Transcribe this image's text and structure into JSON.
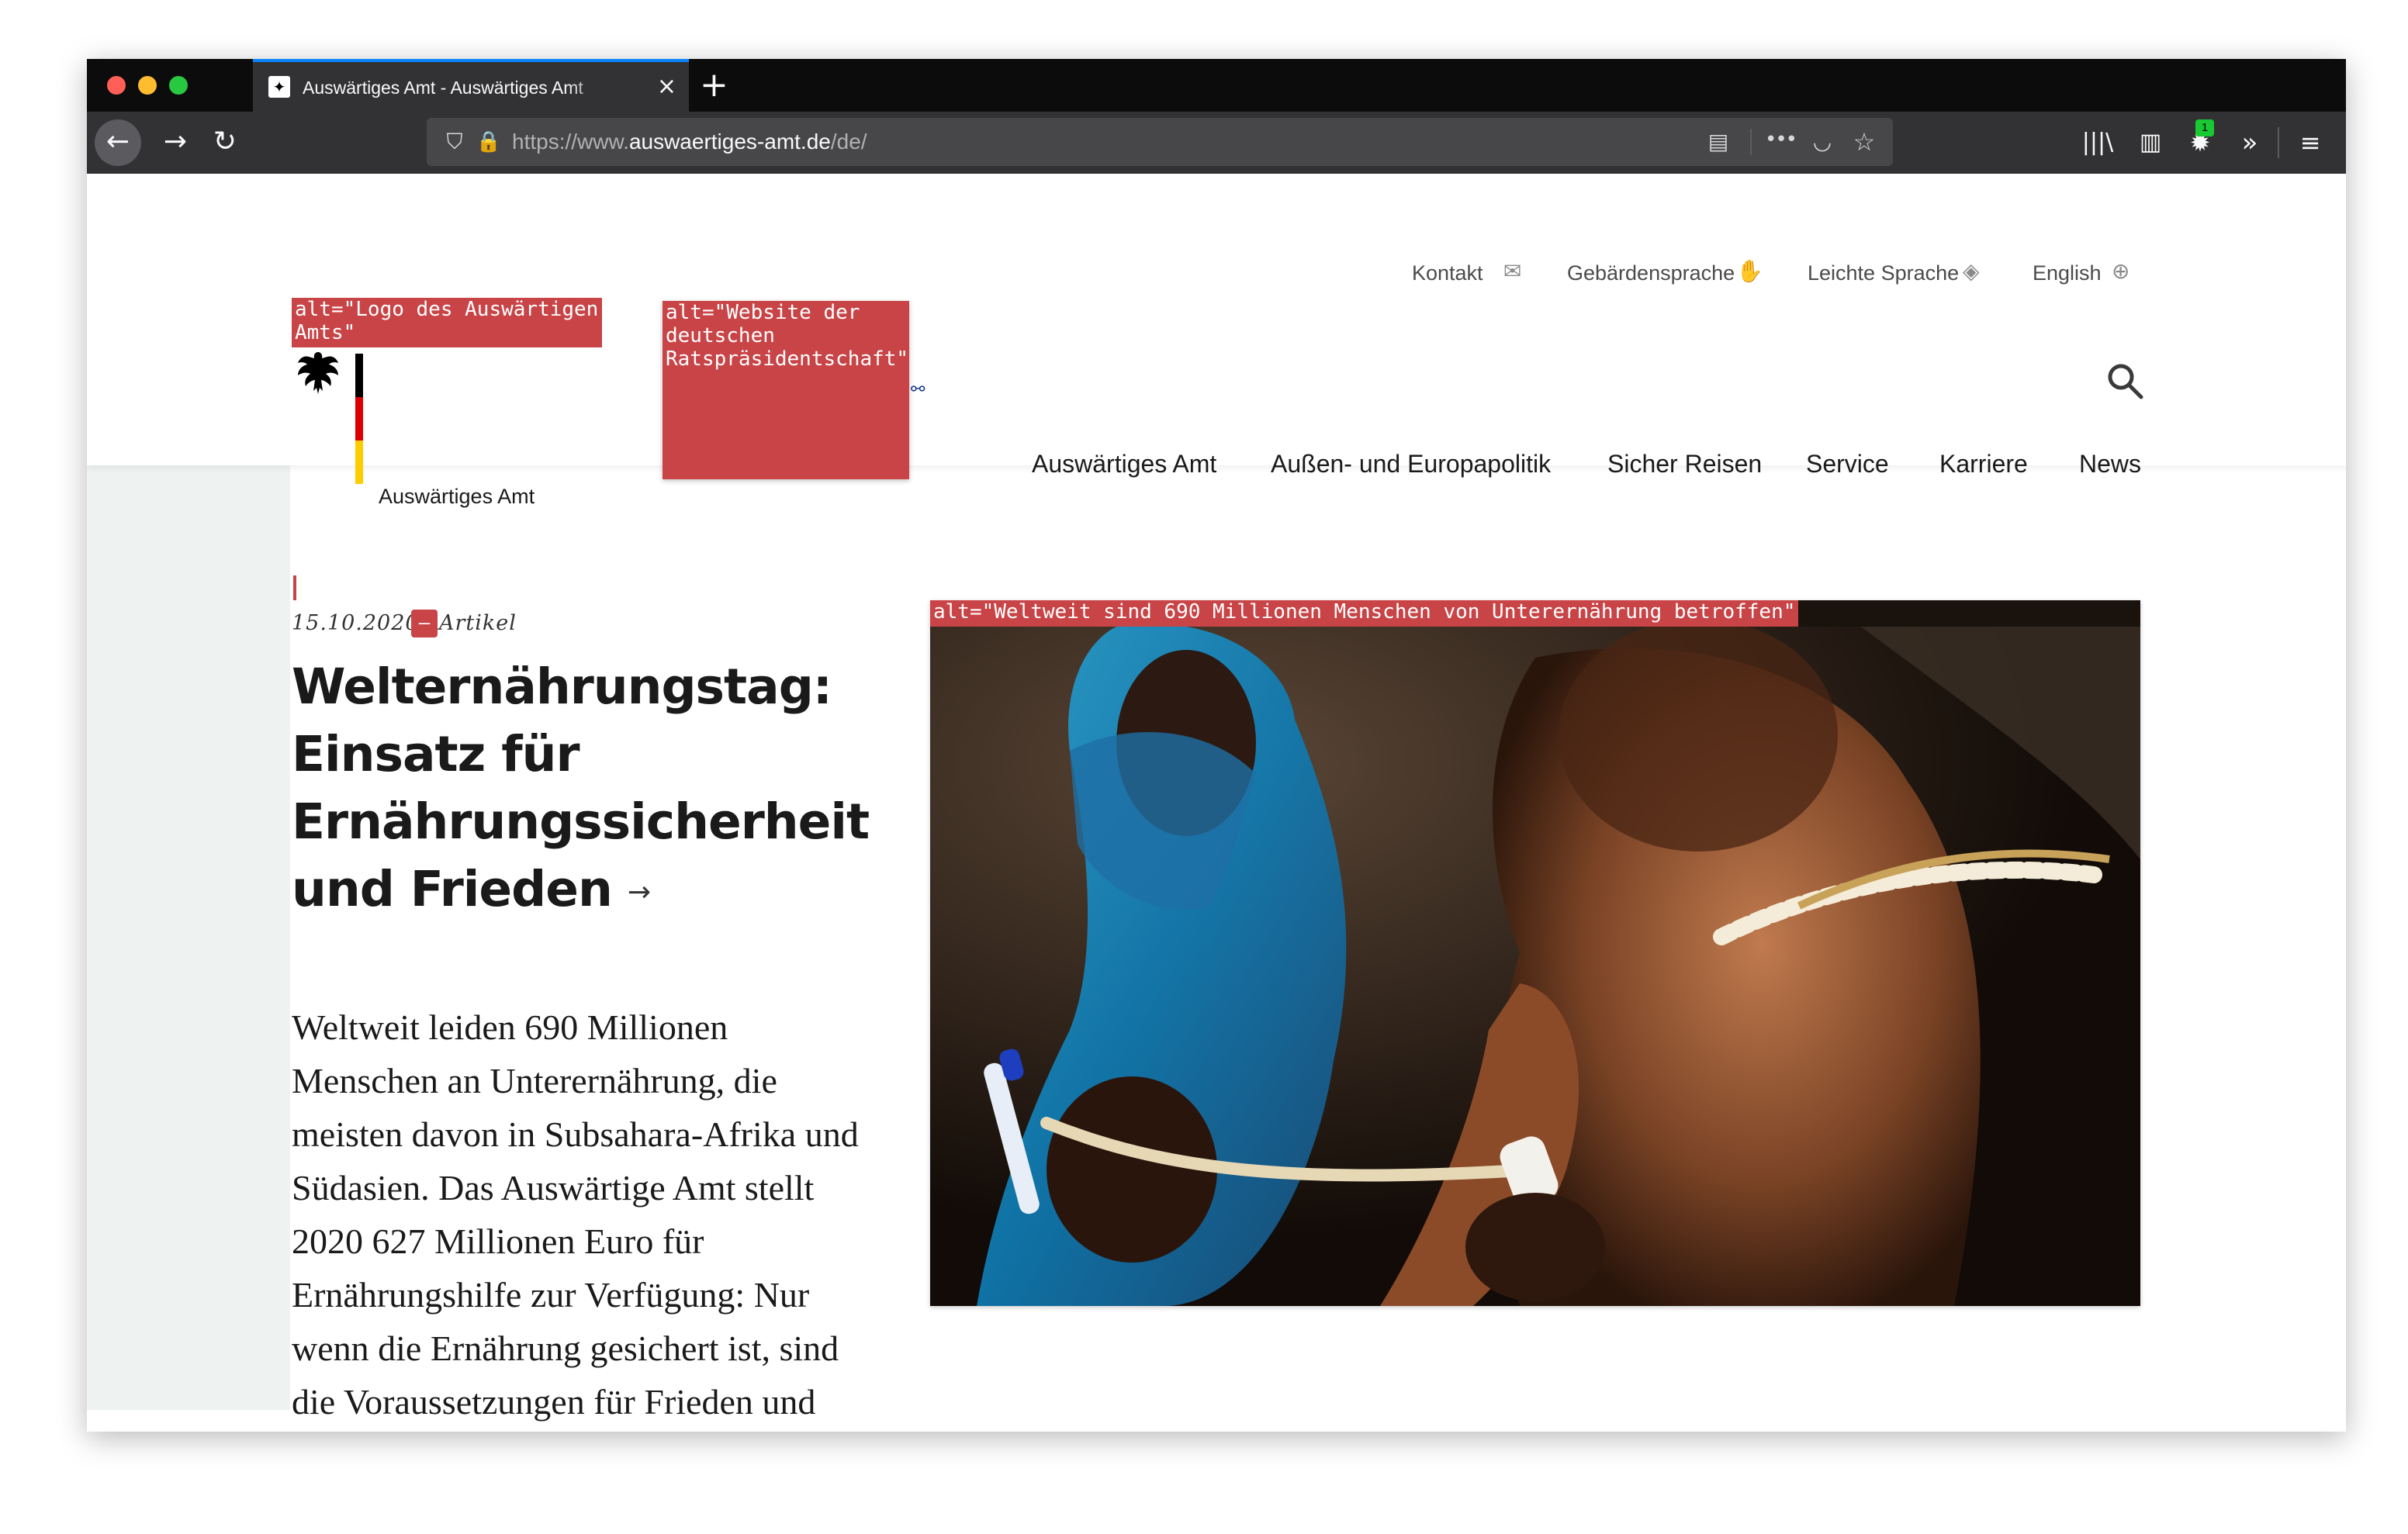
{
  "browser": {
    "tab_title": "Auswärtiges Amt - Auswärtiges Amt",
    "tab_favicon": "eagle-favicon-icon",
    "tab_close": "×",
    "new_tab": "+",
    "url": {
      "prefix": "https://www.",
      "host": "auswaertiges-amt.de",
      "path": "/de/"
    },
    "toolbar_icons": {
      "back": "←",
      "forward": "→",
      "reload": "↻",
      "shield": "⛉",
      "lock": "🔒",
      "reader": "▤",
      "more": "•••",
      "pocket": "◡",
      "star": "☆",
      "library": "|||\\",
      "sidebar": "▥",
      "extension": "✹",
      "overflow": "»",
      "menu": "≡"
    },
    "extension_badge": "1"
  },
  "service_nav": [
    {
      "label": "Kontakt",
      "icon": "✉"
    },
    {
      "label": "Gebärdensprache",
      "icon": "✋"
    },
    {
      "label": "Leichte Sprache",
      "icon": "◈"
    },
    {
      "label": "English",
      "icon": "⊕"
    }
  ],
  "logo": {
    "alt": "alt=\"Logo des Auswärtigen Amts\"",
    "eagle": "🦅",
    "text": "Auswärtiges Amt"
  },
  "presidency": {
    "alt": "alt=\"Website der deutschen Ratspräsidentschaft\"",
    "icon": "⚯"
  },
  "search_icon": "⚲",
  "main_nav": [
    "Auswärtiges Amt",
    "Außen- und Europapolitik",
    "Sicher Reisen",
    "Service",
    "Karriere",
    "News"
  ],
  "teaser": {
    "date": "15.10.2020",
    "separator": "–",
    "type": "Artikel",
    "headline": "Welternährungstag: Einsatz für Ernährungssicherheit und Frieden",
    "arrow": "→",
    "body": "Weltweit leiden 690 Millionen Menschen an Unterernährung, die meisten davon in Subsahara-Afrika und Südasien. Das Auswärtige Amt stellt 2020 627 Millionen Euro für Ernährungshilfe zur Verfügung: Nur wenn die Ernährung gesichert ist, sind die Voraussetzungen für Frieden und Stabilität gegeben.",
    "image_alt": "alt=\"Weltweit sind 690 Millionen Menschen von Unterernährung betroffen\""
  },
  "colors": {
    "alt_label_bg": "#c84447",
    "titlebar": "#0c0c0d",
    "toolbar": "#323234",
    "stripe": "#eef2f1",
    "tab_accent": "#0a84ff",
    "badge": "#18c934"
  }
}
